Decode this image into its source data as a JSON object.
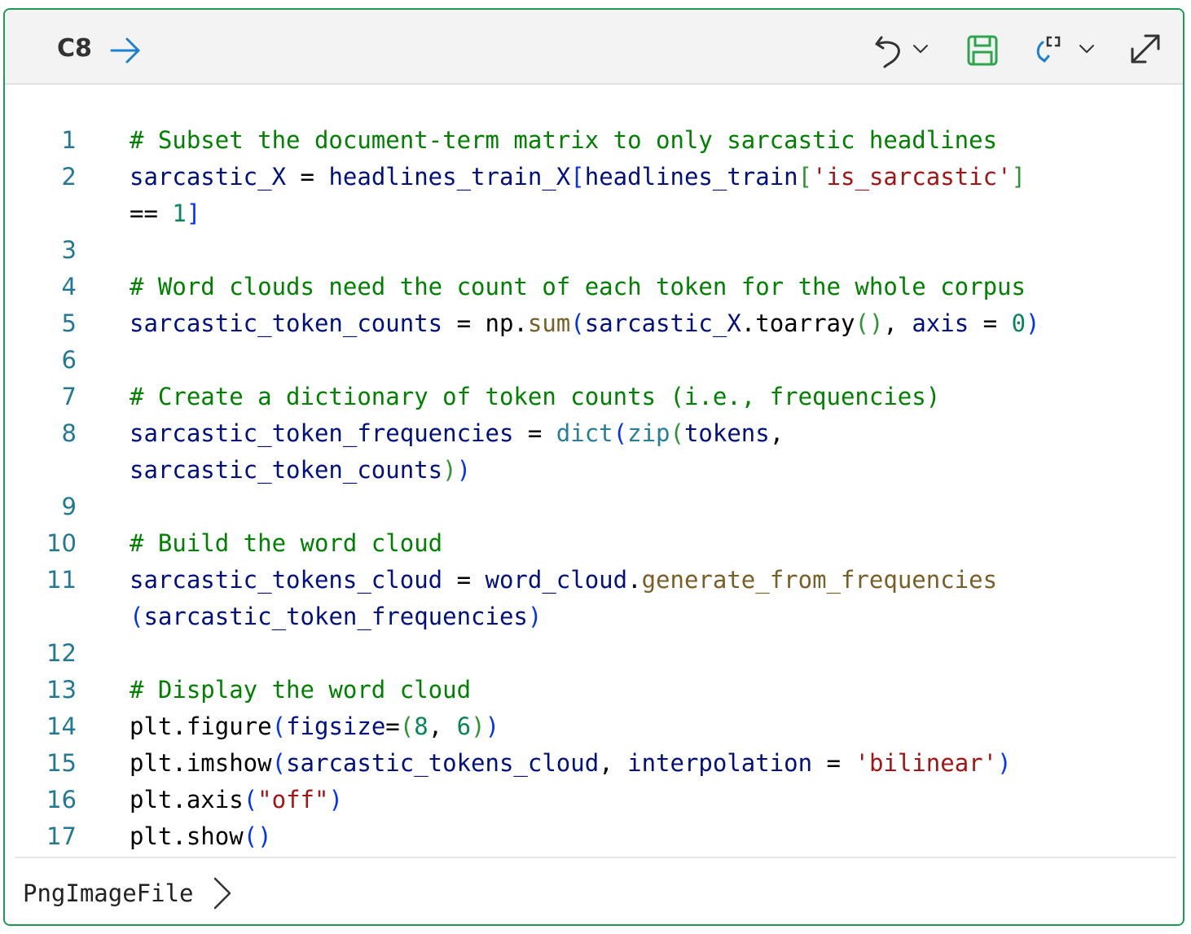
{
  "cell": {
    "ref": "C8",
    "run_icon": "arrow-right-icon",
    "toolbar": [
      "undo-icon",
      "chevron-down-icon",
      "save-icon",
      "refresh-icon",
      "chevron-down-icon",
      "expand-icon"
    ]
  },
  "lines": [
    {
      "num": "1",
      "tokens": [
        {
          "c": "t-comment",
          "t": "# Subset the document-term matrix to only sarcastic headlines"
        }
      ]
    },
    {
      "num": "2",
      "tokens": [
        {
          "c": "t-var",
          "t": "sarcastic_X"
        },
        {
          "c": "t-plain",
          "t": " = "
        },
        {
          "c": "t-var",
          "t": "headlines_train_X"
        },
        {
          "c": "t-p1",
          "t": "["
        },
        {
          "c": "t-var",
          "t": "headlines_train"
        },
        {
          "c": "t-p2",
          "t": "["
        },
        {
          "c": "t-str",
          "t": "'is_sarcastic'"
        },
        {
          "c": "t-p2",
          "t": "]"
        }
      ]
    },
    {
      "num": "",
      "tokens": [
        {
          "c": "t-plain",
          "t": "== "
        },
        {
          "c": "t-num",
          "t": "1"
        },
        {
          "c": "t-p1",
          "t": "]"
        }
      ]
    },
    {
      "num": "3",
      "tokens": []
    },
    {
      "num": "4",
      "tokens": [
        {
          "c": "t-comment",
          "t": "# Word clouds need the count of each token for the whole corpus"
        }
      ]
    },
    {
      "num": "5",
      "tokens": [
        {
          "c": "t-var",
          "t": "sarcastic_token_counts"
        },
        {
          "c": "t-plain",
          "t": " = np."
        },
        {
          "c": "t-fn",
          "t": "sum"
        },
        {
          "c": "t-p1",
          "t": "("
        },
        {
          "c": "t-var",
          "t": "sarcastic_X"
        },
        {
          "c": "t-plain",
          "t": ".toarray"
        },
        {
          "c": "t-p2",
          "t": "()"
        },
        {
          "c": "t-plain",
          "t": ", "
        },
        {
          "c": "t-var",
          "t": "axis"
        },
        {
          "c": "t-plain",
          "t": " = "
        },
        {
          "c": "t-num",
          "t": "0"
        },
        {
          "c": "t-p1",
          "t": ")"
        }
      ]
    },
    {
      "num": "6",
      "tokens": []
    },
    {
      "num": "7",
      "tokens": [
        {
          "c": "t-comment",
          "t": "# Create a dictionary of token counts (i.e., frequencies)"
        }
      ]
    },
    {
      "num": "8",
      "tokens": [
        {
          "c": "t-var",
          "t": "sarcastic_token_frequencies"
        },
        {
          "c": "t-plain",
          "t": " = "
        },
        {
          "c": "t-bi",
          "t": "dict"
        },
        {
          "c": "t-p1",
          "t": "("
        },
        {
          "c": "t-bi",
          "t": "zip"
        },
        {
          "c": "t-p2",
          "t": "("
        },
        {
          "c": "t-var",
          "t": "tokens"
        },
        {
          "c": "t-plain",
          "t": ","
        }
      ]
    },
    {
      "num": "",
      "tokens": [
        {
          "c": "t-var",
          "t": "sarcastic_token_counts"
        },
        {
          "c": "t-p2",
          "t": ")"
        },
        {
          "c": "t-p1",
          "t": ")"
        }
      ]
    },
    {
      "num": "9",
      "tokens": []
    },
    {
      "num": "10",
      "tokens": [
        {
          "c": "t-comment",
          "t": "# Build the word cloud"
        }
      ]
    },
    {
      "num": "11",
      "tokens": [
        {
          "c": "t-var",
          "t": "sarcastic_tokens_cloud"
        },
        {
          "c": "t-plain",
          "t": " = "
        },
        {
          "c": "t-var",
          "t": "word_cloud"
        },
        {
          "c": "t-plain",
          "t": "."
        },
        {
          "c": "t-fn",
          "t": "generate_from_frequencies"
        }
      ]
    },
    {
      "num": "",
      "tokens": [
        {
          "c": "t-p1",
          "t": "("
        },
        {
          "c": "t-var",
          "t": "sarcastic_token_frequencies"
        },
        {
          "c": "t-p1",
          "t": ")"
        }
      ]
    },
    {
      "num": "12",
      "tokens": []
    },
    {
      "num": "13",
      "tokens": [
        {
          "c": "t-comment",
          "t": "# Display the word cloud"
        }
      ]
    },
    {
      "num": "14",
      "tokens": [
        {
          "c": "t-plain",
          "t": "plt.figure"
        },
        {
          "c": "t-p1",
          "t": "("
        },
        {
          "c": "t-var",
          "t": "figsize"
        },
        {
          "c": "t-plain",
          "t": "="
        },
        {
          "c": "t-p2",
          "t": "("
        },
        {
          "c": "t-num",
          "t": "8"
        },
        {
          "c": "t-plain",
          "t": ", "
        },
        {
          "c": "t-num",
          "t": "6"
        },
        {
          "c": "t-p2",
          "t": ")"
        },
        {
          "c": "t-p1",
          "t": ")"
        }
      ]
    },
    {
      "num": "15",
      "tokens": [
        {
          "c": "t-plain",
          "t": "plt.imshow"
        },
        {
          "c": "t-p1",
          "t": "("
        },
        {
          "c": "t-var",
          "t": "sarcastic_tokens_cloud"
        },
        {
          "c": "t-plain",
          "t": ", "
        },
        {
          "c": "t-var",
          "t": "interpolation"
        },
        {
          "c": "t-plain",
          "t": " = "
        },
        {
          "c": "t-str",
          "t": "'bilinear'"
        },
        {
          "c": "t-p1",
          "t": ")"
        }
      ]
    },
    {
      "num": "16",
      "tokens": [
        {
          "c": "t-plain",
          "t": "plt.axis"
        },
        {
          "c": "t-p1",
          "t": "("
        },
        {
          "c": "t-str",
          "t": "\"off\""
        },
        {
          "c": "t-p1",
          "t": ")"
        }
      ]
    },
    {
      "num": "17",
      "tokens": [
        {
          "c": "t-plain",
          "t": "plt.show"
        },
        {
          "c": "t-p1",
          "t": "()"
        }
      ]
    }
  ],
  "output": {
    "label": "PngImageFile",
    "expand_icon": "chevron-right-icon"
  }
}
